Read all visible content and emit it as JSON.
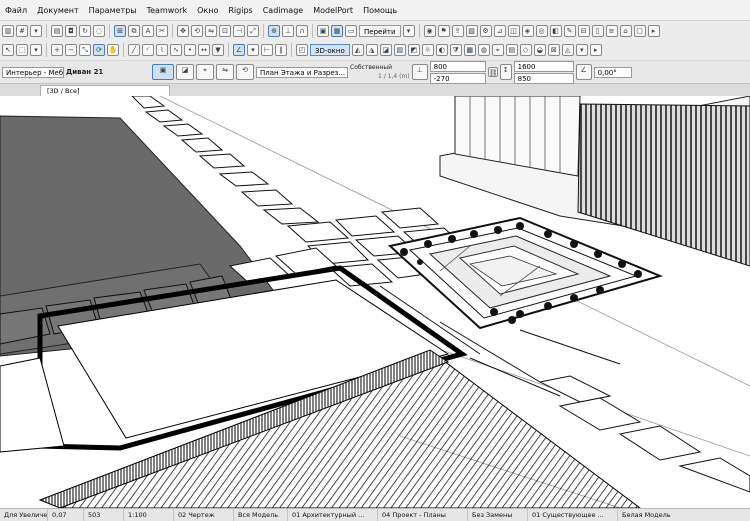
{
  "menu": [
    "Файл",
    "Документ",
    "Параметры",
    "Teamwork",
    "Окно",
    "Rigips",
    "Cadimage",
    "ModelPort",
    "Помощь"
  ],
  "toolbar1": {
    "go_to": "Перейти"
  },
  "toolbar2": {
    "view_3d": "3D-окно"
  },
  "infobox": {
    "layer": "Интерьер - Мебель",
    "object_name": "Диван 21",
    "view_select": "План Этажа и Разрез...",
    "own_floor": "Собственный",
    "ratio_label": "1 / 1,4 (m)",
    "dim_a": "800",
    "dim_b": "-270",
    "dim_c": "1600",
    "dim_d": "850",
    "angle": "0,00°"
  },
  "tab": {
    "title": "[3D / Все]"
  },
  "status": {
    "zoom": "Для Увеличения",
    "pan": "0,07",
    "value": "503",
    "scale": "1:100",
    "layer_combo": "02 Чертеж",
    "model_view": "Вся Модель",
    "pen_set": "01 Архитектурный ...",
    "mvo": "04 Проект - Планы",
    "renovation": "Без Замены",
    "phase": "01 Существующее ...",
    "surface": "Белая Модель"
  },
  "colors": {
    "accent": "#4a7fb8",
    "shadow": "#6a6a6a",
    "chrome": "#ececec"
  }
}
